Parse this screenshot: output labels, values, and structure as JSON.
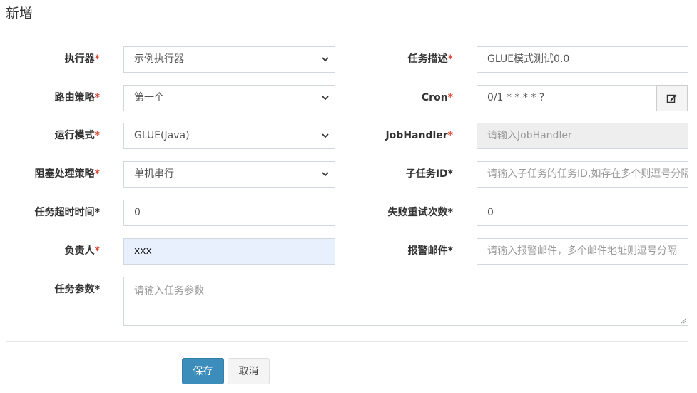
{
  "modal": {
    "title": "新增"
  },
  "form": {
    "executor": {
      "label": "执行器",
      "required": "*",
      "value": "示例执行器"
    },
    "job_desc": {
      "label": "任务描述",
      "required": "*",
      "value": "GLUE模式测试0.0"
    },
    "route_strategy": {
      "label": "路由策略",
      "required": "*",
      "value": "第一个"
    },
    "cron": {
      "label": "Cron",
      "required": "*",
      "value": "0/1 * * * * ?"
    },
    "run_mode": {
      "label": "运行模式",
      "required": "*",
      "value": "GLUE(Java)"
    },
    "job_handler": {
      "label": "JobHandler",
      "required": "*",
      "placeholder": "请输入JobHandler"
    },
    "block_strategy": {
      "label": "阻塞处理策略",
      "required": "*",
      "value": "单机串行"
    },
    "child_job_id": {
      "label": "子任务ID*",
      "placeholder": "请输入子任务的任务ID,如存在多个则逗号分隔"
    },
    "timeout": {
      "label": "任务超时时间*",
      "value": "0"
    },
    "fail_retry": {
      "label": "失败重试次数*",
      "value": "0"
    },
    "author": {
      "label": "负责人",
      "required": "*",
      "value": "xxx"
    },
    "alarm_email": {
      "label": "报警邮件*",
      "placeholder": "请输入报警邮件，多个邮件地址则逗号分隔"
    },
    "executor_param": {
      "label": "任务参数*",
      "placeholder": "请输入任务参数"
    }
  },
  "buttons": {
    "save": "保存",
    "cancel": "取消"
  },
  "icons": {
    "cron_edit": "edit-icon",
    "select_arrow": "chevron-down-icon"
  },
  "colors": {
    "primary": "#3c8dbc",
    "required": "#dd4b39",
    "autofill": "#e8f0fe",
    "disabled": "#eeeeee"
  }
}
